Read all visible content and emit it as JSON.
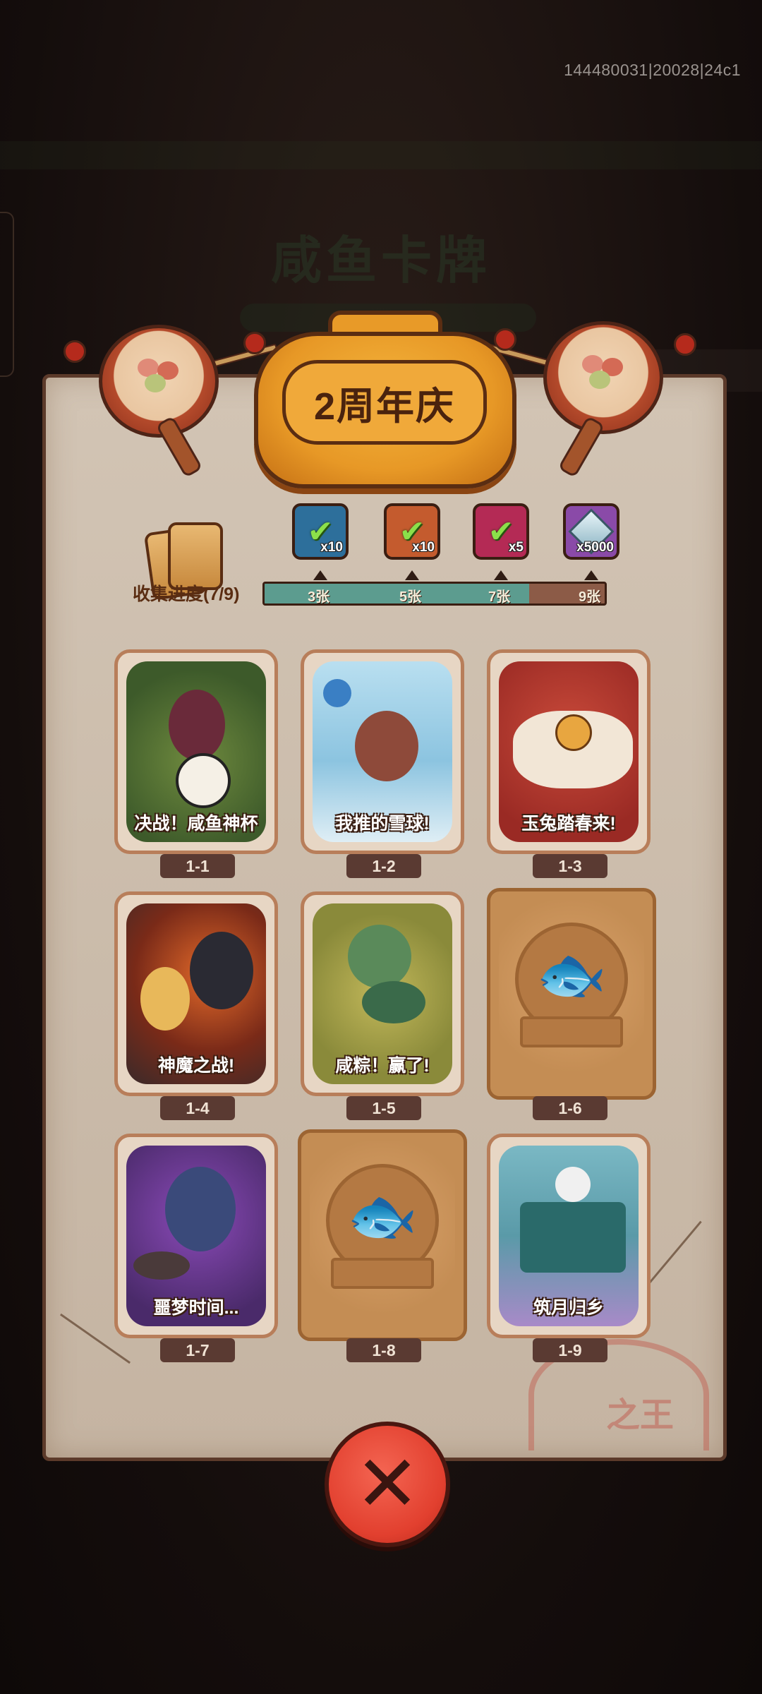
{
  "build_id": "144480031|20028|24c1",
  "background": {
    "title": "咸鱼卡牌"
  },
  "header": {
    "title": "2周年庆"
  },
  "progress": {
    "label": "收集进度(7/9)",
    "collected": 7,
    "total": 9,
    "milestones": [
      {
        "count_label": "3张",
        "reward_icon": "treasure-chest-icon",
        "reward_qty": "x10",
        "color": "#2d6f9b"
      },
      {
        "count_label": "5张",
        "reward_icon": "scroll-key-icon",
        "reward_qty": "x10",
        "color": "#c45b2e"
      },
      {
        "count_label": "7张",
        "reward_icon": "rainbow-orb-icon",
        "reward_qty": "x5",
        "color": "#b42a55"
      },
      {
        "count_label": "9张",
        "reward_icon": "crystal-gem-icon",
        "reward_qty": "x5000",
        "color": "#8a4aa8"
      }
    ]
  },
  "cards": [
    {
      "id": "1-1",
      "title": "决战！咸鱼神杯",
      "unlocked": true
    },
    {
      "id": "1-2",
      "title": "我推的雪球!",
      "unlocked": true
    },
    {
      "id": "1-3",
      "title": "玉兔踏春来!",
      "unlocked": true
    },
    {
      "id": "1-4",
      "title": "神魔之战!",
      "unlocked": true
    },
    {
      "id": "1-5",
      "title": "咸粽！赢了!",
      "unlocked": true
    },
    {
      "id": "1-6",
      "title": "",
      "unlocked": false
    },
    {
      "id": "1-7",
      "title": "噩梦时间...",
      "unlocked": true
    },
    {
      "id": "1-8",
      "title": "",
      "unlocked": false
    },
    {
      "id": "1-9",
      "title": "筑月归乡",
      "unlocked": true
    }
  ],
  "stamp_text": "咸鱼之王",
  "close_icon": "close-x-icon"
}
